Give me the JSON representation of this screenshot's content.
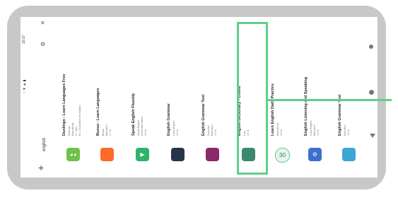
{
  "status_bar": {
    "time": "10:27",
    "icons": "↑ ▼ ▲ ▮"
  },
  "toolbar": {
    "search_text": "english",
    "add_icon": "plus-icon",
    "back_icon": "back-arrow-icon",
    "settings_icon": "gear-icon",
    "close_icon": "close-icon"
  },
  "results": [
    {
      "title": "Duolingo - Learn Languages Free",
      "lines": [
        "Duolingo",
        "Educational",
        "4.7 stars",
        "No. 1 Education ★ Installed"
      ],
      "icon_color": "#6cc24a",
      "icon_glyph": "◕◕"
    },
    {
      "title": "Busuu - Learn Languages",
      "lines": [
        "Busuu",
        "Education",
        "4.7 ★"
      ],
      "icon_color": "#ff6a2b",
      "icon_glyph": ""
    },
    {
      "title": "Speak English Fluently",
      "lines": [
        "Speak English",
        "Learn with videos",
        "4.6 ★"
      ],
      "icon_color": "#2db36b",
      "icon_glyph": "▶"
    },
    {
      "title": "English Grammar",
      "lines": [
        "Learn English",
        "4.6 ★"
      ],
      "icon_color": "#26354a",
      "icon_glyph": ""
    },
    {
      "title": "English Grammar Test",
      "lines": [
        "Grammar",
        "Education",
        "4.5 ★"
      ],
      "icon_color": "#8a2a6a",
      "icon_glyph": ""
    },
    {
      "title": "English Dictionary - Offline",
      "lines": [
        "Livio",
        "4.6 ★"
      ],
      "icon_color": "#3b8a6e",
      "icon_glyph": ""
    },
    {
      "title": "Learn English Daily Practice",
      "lines": [
        "Educational",
        "4.6 ★"
      ],
      "icon_color": "#e8f4ec",
      "icon_glyph": "30"
    },
    {
      "title": "English Listening and Speaking",
      "lines": [
        "Learn English",
        "Education",
        "4.6 ★"
      ],
      "icon_color": "#3d6fd1",
      "icon_glyph": "⚙"
    },
    {
      "title": "English Grammar Test",
      "lines": [
        "Education",
        "4.5 ★"
      ],
      "icon_color": "#3aa7d4",
      "icon_glyph": ""
    }
  ],
  "nav": {
    "back": "back-icon",
    "home": "home-icon",
    "recents": "recents-icon"
  },
  "colors": {
    "highlight": "#5fcf8a",
    "frame": "#c8c8c8"
  }
}
